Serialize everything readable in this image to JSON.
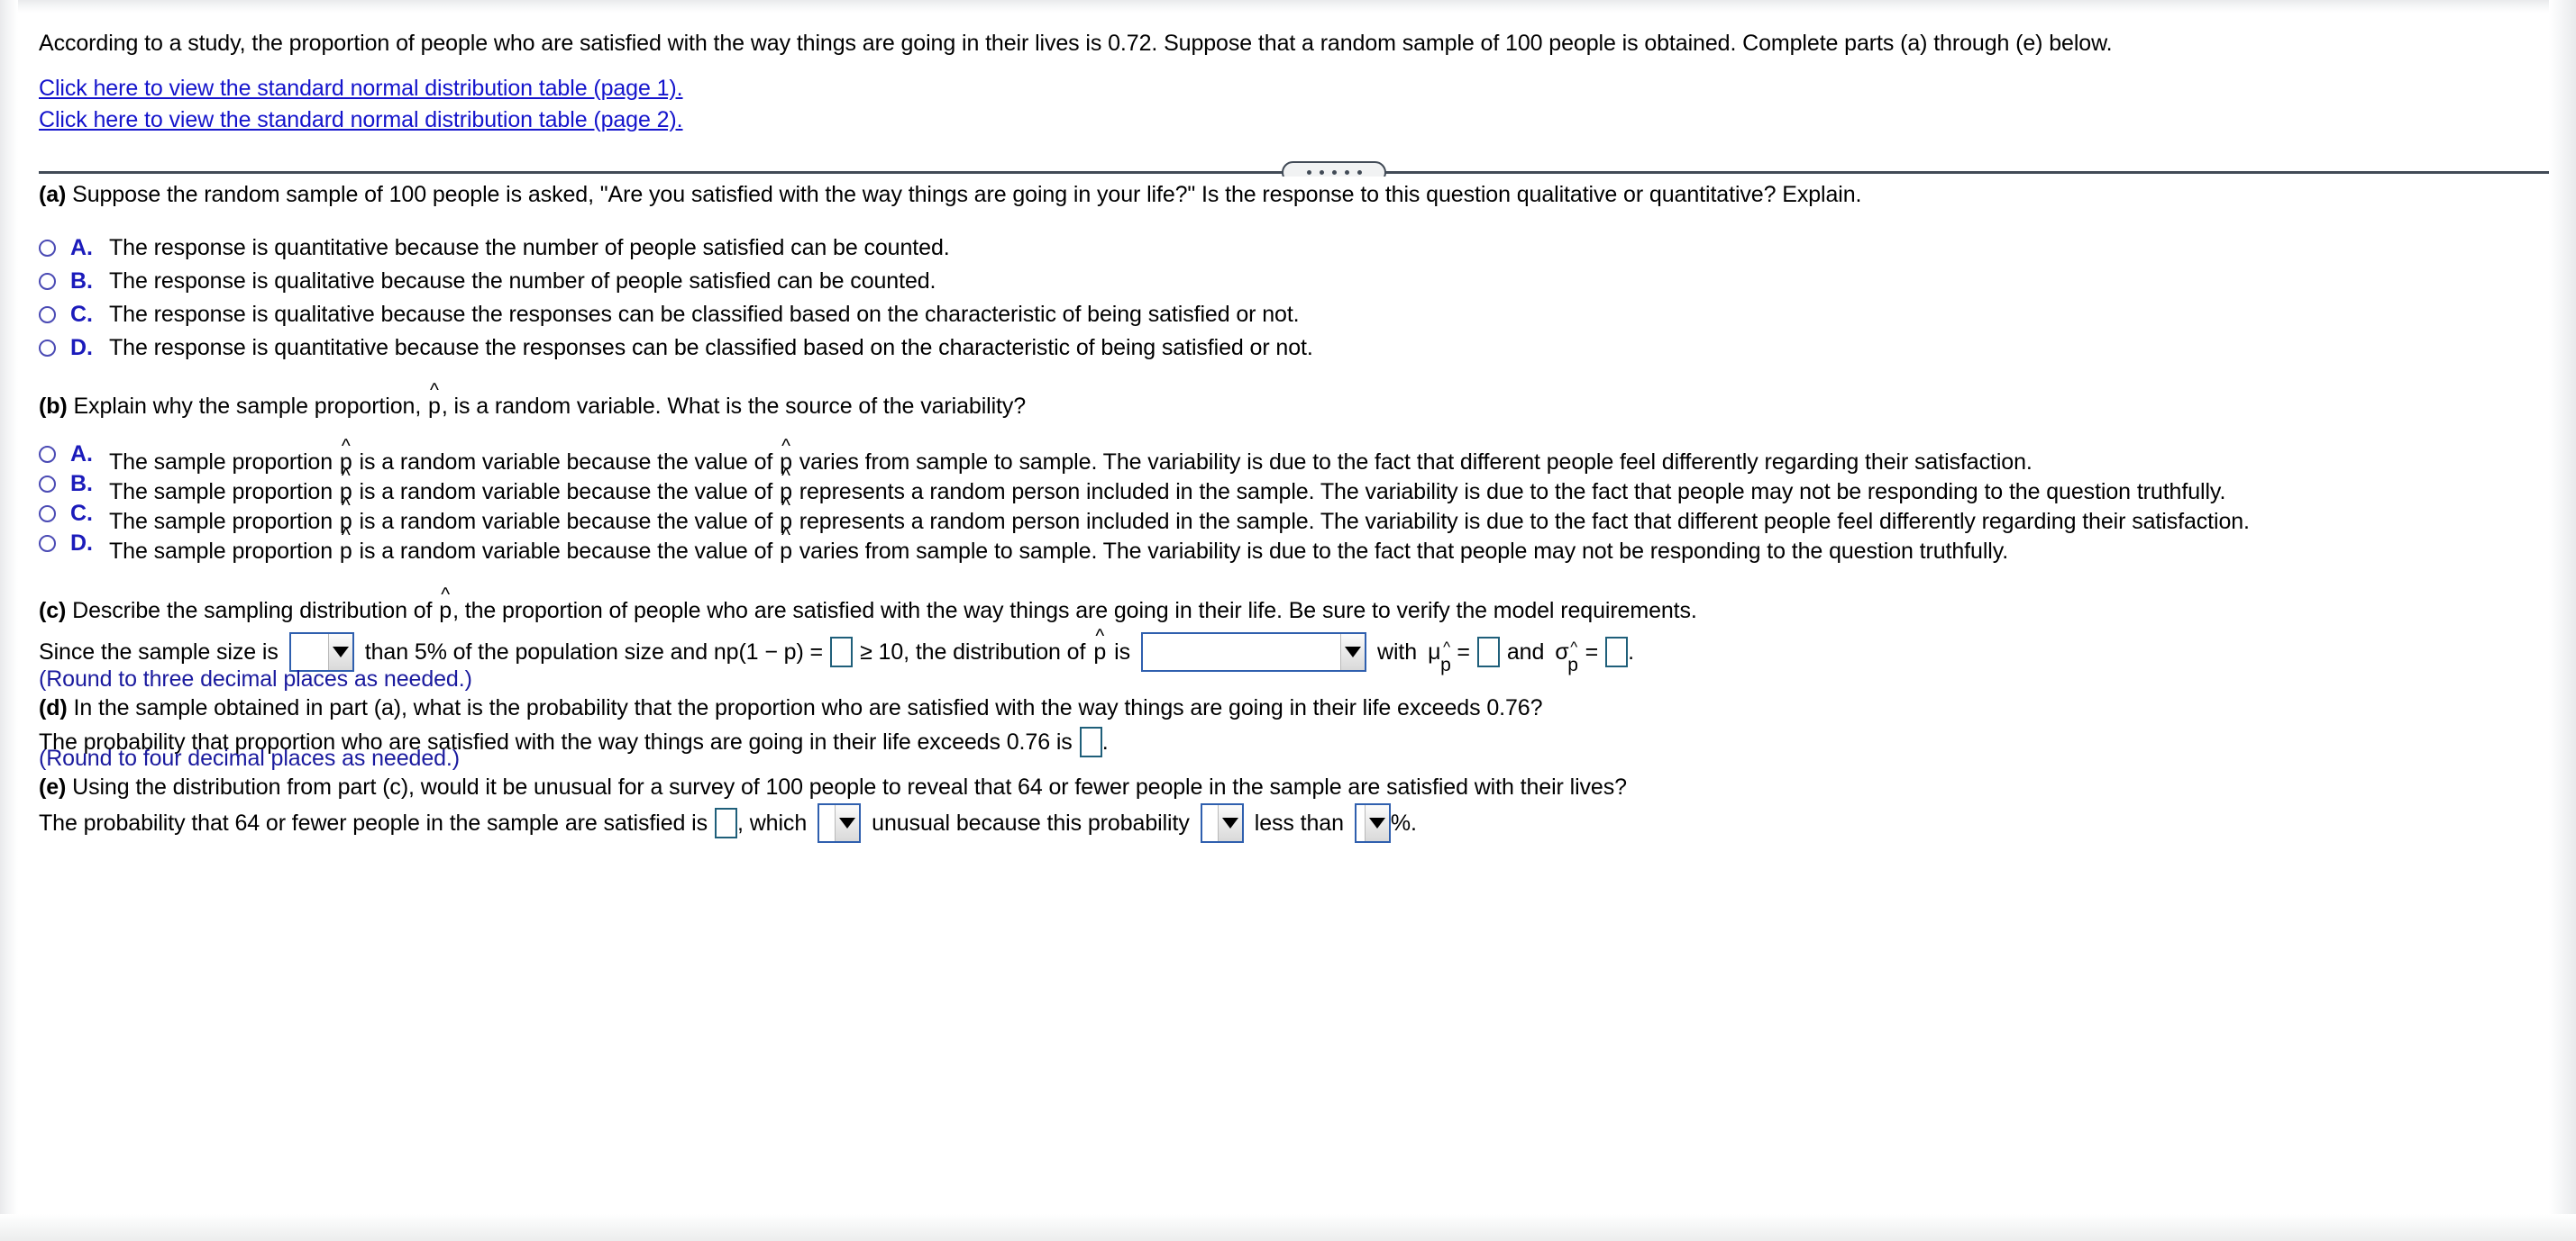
{
  "stem": {
    "text": "According to a study, the proportion of people who are satisfied with the way things are going in their lives is 0.72. Suppose that a random sample of 100 people is obtained. Complete parts (a) through (e) below.",
    "link1": "Click here to view the standard normal distribution table (page 1).",
    "link2": "Click here to view the standard normal distribution table (page 2)."
  },
  "splitter": {
    "dots": 5
  },
  "parts": {
    "a": {
      "label": "(a)",
      "prompt": "Suppose the random sample of 100 people is asked, \"Are you satisfied with the way things are going in your life?\" Is the response to this question qualitative or quantitative? Explain.",
      "choices": [
        {
          "letter": "A.",
          "text": "The response is quantitative because the number of people satisfied can be counted."
        },
        {
          "letter": "B.",
          "text": "The response is qualitative because the number of people satisfied can be counted."
        },
        {
          "letter": "C.",
          "text": "The response is qualitative because the responses can be classified based on the characteristic of being satisfied or not."
        },
        {
          "letter": "D.",
          "text": "The response is quantitative because the responses can be classified based on the characteristic of being satisfied or not."
        }
      ]
    },
    "b": {
      "label": "(b)",
      "prompt_pre": "Explain why the sample proportion, ",
      "prompt_symbol": "p",
      "prompt_post": ", is a random variable. What is the source of the variability?",
      "choices": [
        {
          "letter": "A.",
          "seg1": "The sample proportion ",
          "sym1": "p",
          "seg2": " is a random variable because the value of ",
          "sym2": "p",
          "seg3": " varies from sample to sample. The variability is due to the fact that different people feel differently regarding their satisfaction."
        },
        {
          "letter": "B.",
          "seg1": "The sample proportion ",
          "sym1": "p",
          "seg2": " is a random variable because the value of ",
          "sym2": "p",
          "seg3": " represents a random person included in the sample. The variability is due to the fact that people may not be responding to the question truthfully."
        },
        {
          "letter": "C.",
          "seg1": "The sample proportion ",
          "sym1": "p",
          "seg2": " is a random variable because the value of ",
          "sym2": "p",
          "seg3": " represents a random person included in the sample. The variability is due to the fact that different people feel differently regarding their satisfaction."
        },
        {
          "letter": "D.",
          "seg1": "The sample proportion ",
          "sym1": "p",
          "seg2": " is a random variable because the value of ",
          "sym2": "p",
          "seg3": " varies from sample to sample. The variability is due to the fact that people may not be responding to the question truthfully."
        }
      ]
    },
    "c": {
      "label": "(c)",
      "prompt_pre": "Describe the sampling distribution of ",
      "prompt_symbol": "p",
      "prompt_post": ", the proportion of people who are satisfied with the way things are going in their life. Be sure to verify the model requirements.",
      "answer": {
        "seg1": "Since the sample size is",
        "dropdown1_value": "",
        "seg2": "than 5% of the population size and np(1 − p) =",
        "box1_value": "",
        "seg3": "≥ 10, the distribution of",
        "symbol1": "p",
        "seg4": "is",
        "dropdown2_value": "",
        "seg5": "with",
        "mu_symbol": "μ",
        "mu_sub": "p",
        "eq1": "=",
        "box2_value": "",
        "seg6": "and",
        "sigma_symbol": "σ",
        "sigma_sub": "p",
        "eq2": "=",
        "box3_value": "",
        "seg7": "."
      },
      "note": "(Round to three decimal places as needed.)"
    },
    "d": {
      "label": "(d)",
      "prompt": "In the sample obtained in part (a), what is the probability that the proportion who are satisfied with the way things are going in their life exceeds 0.76?",
      "answer": {
        "seg1": "The probability that proportion who are satisfied with the way things are going in their life exceeds 0.76 is",
        "box1_value": "",
        "seg2": "."
      },
      "note": "(Round to four decimal places as needed.)"
    },
    "e": {
      "label": "(e)",
      "prompt": "Using the distribution from part (c), would it be unusual for a survey of 100 people to reveal that 64 or fewer people in the sample are satisfied with their lives?",
      "answer": {
        "seg1": "The probability that 64 or fewer people in the sample are satisfied is",
        "box1_value": "",
        "seg2": ", which",
        "dropdown1_value": "",
        "seg3": "unusual because this probability",
        "dropdown2_value": "",
        "seg4": "less than",
        "dropdown3_value": "",
        "seg5": "%."
      }
    }
  },
  "colors": {
    "link": "#1414CC",
    "note_text": "#1A1A9E",
    "choice_letter": "#1B1BBB",
    "radio_border": "#4A4AB4",
    "fillbox_border": "#1F5F7A",
    "dropdown_border": "#2F5FAE",
    "splitter": "#414A56"
  }
}
